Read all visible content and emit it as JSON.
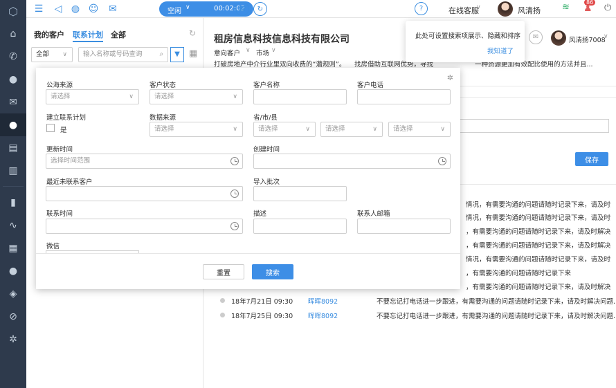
{
  "nav": {
    "items": [
      "home-icon",
      "phone-icon",
      "chat-icon",
      "mail-icon",
      "user-icon",
      "clipboard-icon",
      "book-icon",
      "chart-icon",
      "pulse-icon",
      "calendar-icon",
      "message-icon",
      "shield-icon",
      "link-icon",
      "gear-icon"
    ]
  },
  "topbar": {
    "status": "空闲",
    "timer": "00:02:02",
    "service_label": "在线客服",
    "user_name": "风清扬",
    "badge_count": "86"
  },
  "left": {
    "tabs": [
      "我的客户",
      "联系计划",
      "全部"
    ],
    "filter_value": "全部",
    "search_placeholder": "输入名称或号码查询"
  },
  "detail": {
    "company": "租房信息科技信息科技有限公司",
    "tag1": "意向客户",
    "tag2": "市场",
    "desc": "打破房地产中介行业里双向收费的“潜规则”。",
    "desc2": "找房借助互联网优势，寻找",
    "desc3": "一种资源更加有效配比使用的方法并且...",
    "agent_name": "风清扬7008",
    "save_label": "保存"
  },
  "tip": {
    "text": "此处可设置搜索项展示、隐藏和排序",
    "ok": "我知道了"
  },
  "panel": {
    "labels": {
      "pool_source": "公海来源",
      "customer_status": "客户状态",
      "customer_name": "客户名称",
      "customer_phone": "客户电话",
      "create_plan": "建立联系计划",
      "data_source": "数据来源",
      "region": "省/市/县",
      "update_time": "更新时间",
      "create_time": "创建时间",
      "recent_customer": "最近未联系客户",
      "import_batch": "导入批次",
      "contact_time": "联系时间",
      "description": "描述",
      "contact_email": "联系人邮箱",
      "wechat": "微信"
    },
    "placeholders": {
      "select": "请选择",
      "time_range": "选择时间范围"
    },
    "checkbox_label": "是",
    "reset": "重置",
    "search": "搜索"
  },
  "log_truncated": [
    "情况，有需要沟通的问题请随时记录下来，请及时沟...",
    "情况，有需要沟通的问题请随时记录下来，请及时沟...",
    "，有需要沟通的问题请随时记录下来，请及时解决问...",
    "，有需要沟通的问题请随时记录下来，请及时解决问...",
    "问，有需要沟通的问题请随时记录下来",
    "情况，有需要沟通的问题请随时记录下来，请及时沟...",
    "，有需要沟通的问题请随时记录下来",
    "，有需要沟通的问题请随时记录下来，请及时解决问..."
  ],
  "log": [
    {
      "date": "18年7月21日  09:30",
      "user": "晖晖8092",
      "text": "不要忘记打电话进一步跟进，有需要沟通的问题请随时记录下来，请及时解决问题..."
    },
    {
      "date": "18年7月25日  09:30",
      "user": "晖晖8092",
      "text": "不要忘记打电话进一步跟进，有需要沟通的问题请随时记录下来，请及时解决问题..."
    }
  ]
}
